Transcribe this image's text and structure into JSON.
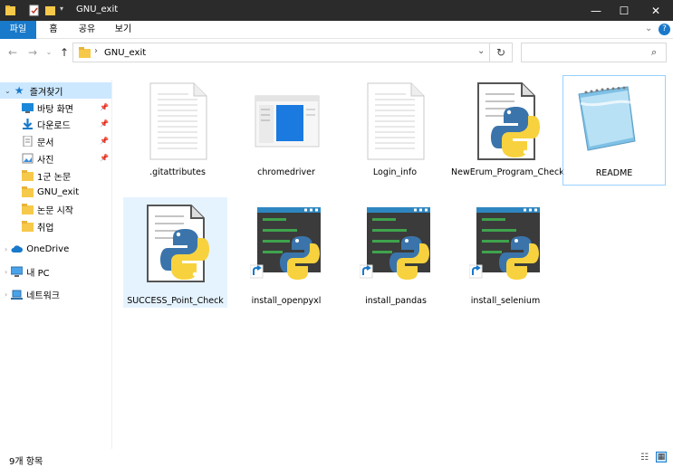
{
  "window": {
    "title": "GNU_exit",
    "minimize": "—",
    "maximize": "☐",
    "close": "✕"
  },
  "ribbon": {
    "tabs": [
      "파일",
      "홈",
      "공유",
      "보기"
    ]
  },
  "address": {
    "path": "GNU_exit",
    "search_placeholder": ""
  },
  "sidebar": {
    "quick_access": "즐겨찾기",
    "pinned": [
      "바탕 화면",
      "다운로드",
      "문서",
      "사진"
    ],
    "folders": [
      "1군 논문",
      "GNU_exit",
      "논문 시작",
      "취업"
    ],
    "onedrive": "OneDrive",
    "pc": "내 PC",
    "network": "네트워크"
  },
  "files": [
    {
      "name": ".gitattributes",
      "icon": "text-file-icon"
    },
    {
      "name": "chromedriver",
      "icon": "executable-window-icon"
    },
    {
      "name": "Login_info",
      "icon": "text-file-icon"
    },
    {
      "name": "NewErum_Program_Check",
      "icon": "python-file-icon"
    },
    {
      "name": "README",
      "icon": "notepad-icon"
    },
    {
      "name": "SUCCESS_Point_Check",
      "icon": "python-file-icon"
    },
    {
      "name": "install_openpyxl",
      "icon": "python-shortcut-icon"
    },
    {
      "name": "install_pandas",
      "icon": "python-shortcut-icon"
    },
    {
      "name": "install_selenium",
      "icon": "python-shortcut-icon"
    }
  ],
  "status": {
    "item_count": "9개 항목"
  },
  "colors": {
    "titlebar": "#2b2b2b",
    "accent": "#1979ca",
    "selection": "#e5f3ff"
  }
}
